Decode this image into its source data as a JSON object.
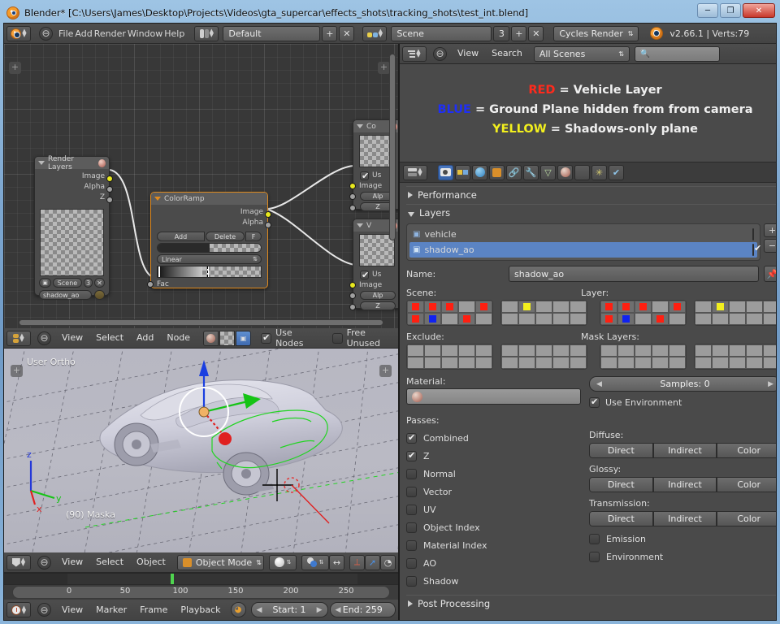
{
  "window": {
    "title": "Blender* [C:\\Users\\James\\Desktop\\Projects\\Videos\\gta_supercar\\effects_shots\\tracking_shots\\test_int.blend]",
    "minimize": "─",
    "maximize": "❐",
    "close": "✕",
    "app_icon": "blender-logo-icon"
  },
  "topbar": {
    "editor_type": "info-editor-icon",
    "menus": [
      "File",
      "Add",
      "Render",
      "Window",
      "Help"
    ],
    "screen_layout_icon": "screen-layout-icon",
    "screen_layout": "Default",
    "screen_add": "+",
    "screen_delete": "✕",
    "scene_icon": "scene-icon",
    "scene_name": "Scene",
    "scene_users": "3",
    "scene_add": "+",
    "scene_delete": "✕",
    "render_engine": "Cycles Render",
    "version_text": "v2.66.1 | Verts:79"
  },
  "node_editor": {
    "header": {
      "editor_type": "node-editor-icon",
      "menus": [
        "View",
        "Select",
        "Add",
        "Node"
      ],
      "shader_icon": "material-shading-icon",
      "texture_icon": "texture-icon",
      "compositing_icon": "compositing-icon",
      "use_nodes_label": "Use Nodes",
      "use_nodes_checked": true,
      "free_unused_label": "Free Unused",
      "free_unused_checked": false
    },
    "nodes": [
      {
        "name": "Render Layers",
        "title": "Render Layers",
        "outputs": [
          "Image",
          "Alpha",
          "Z"
        ],
        "scene_field": "Scene",
        "scene_users": "3",
        "layer_field": "shadow_ao"
      },
      {
        "name": "ColorRamp",
        "title": "ColorRamp",
        "outputs": [
          "Image",
          "Alpha"
        ],
        "add_label": "Add",
        "delete_label": "Delete",
        "f_label": "F",
        "interpolation": "Linear",
        "input": "Fac"
      },
      {
        "name": "Composite",
        "title": "Co",
        "use_label": "Us",
        "inputs": [
          "Image",
          "Alp",
          "Z"
        ]
      },
      {
        "name": "Viewer",
        "title": "V",
        "use_label": "Us",
        "inputs": [
          "Image",
          "Alp",
          "Z"
        ]
      }
    ]
  },
  "viewport": {
    "view_label": "User Ortho",
    "object_label": "(90) Maska",
    "axis": {
      "z": "z",
      "y": "y",
      "x": "x"
    },
    "header": {
      "editor_type": "3d-view-icon",
      "menus": [
        "View",
        "Select",
        "Object"
      ],
      "mode_icon": "object-mode-icon",
      "mode": "Object Mode",
      "shading": "solid-shading-icon",
      "pivot": "pivot-icon",
      "snap": "snap-icon",
      "manipulator": "manipulator-icon",
      "transform": "transform-arrow-icon"
    }
  },
  "timeline": {
    "ticks": [
      "0",
      "50",
      "100",
      "150",
      "200",
      "250"
    ],
    "current_frame_marker": 90,
    "header": {
      "editor_type": "timeline-icon",
      "menus": [
        "View",
        "Marker",
        "Frame",
        "Playback"
      ],
      "sync_icon": "sync-icon",
      "start_label": "Start: 1",
      "end_label": "End: 259"
    }
  },
  "outliner": {
    "editor_type": "outliner-icon",
    "menus": [
      "View",
      "Search"
    ],
    "display_mode": "All Scenes",
    "search_icon": "search-icon",
    "search_value": "",
    "search_placeholder": ""
  },
  "note": {
    "lines": [
      {
        "key": "RED",
        "key_color": "#ff2a1c",
        "text": " = Vehicle Layer"
      },
      {
        "key": "BLUE",
        "key_color": "#1f2ff5",
        "text": " = Ground Plane hidden from from camera"
      },
      {
        "key": "YELLOW",
        "key_color": "#f2ef1e",
        "text": " = Shadows-only plane"
      }
    ]
  },
  "properties": {
    "editor_type": "properties-icon",
    "tabs": [
      {
        "name": "render",
        "icon": "camera-icon",
        "active": true
      },
      {
        "name": "scene",
        "icon": "scene-icon",
        "active": false
      },
      {
        "name": "world",
        "icon": "world-icon",
        "active": false
      },
      {
        "name": "object",
        "icon": "cube-icon",
        "active": false
      },
      {
        "name": "constraints",
        "icon": "chain-icon",
        "active": false
      },
      {
        "name": "modifiers",
        "icon": "wrench-icon",
        "active": false
      },
      {
        "name": "data",
        "icon": "mesh-data-icon",
        "active": false
      },
      {
        "name": "material",
        "icon": "material-sphere-icon",
        "active": false
      },
      {
        "name": "texture",
        "icon": "checker-texture-icon",
        "active": false
      },
      {
        "name": "particles",
        "icon": "particles-icon",
        "active": false
      },
      {
        "name": "physics",
        "icon": "physics-icon",
        "active": false
      }
    ],
    "panels": {
      "performance": {
        "label": "Performance",
        "open": false
      },
      "layers": {
        "label": "Layers",
        "open": true
      },
      "post_processing": {
        "label": "Post Processing",
        "open": false
      }
    },
    "render_layers": [
      {
        "name": "vehicle",
        "enabled": false,
        "selected": false,
        "icon": "renderlayer-icon"
      },
      {
        "name": "shadow_ao",
        "enabled": true,
        "selected": true,
        "icon": "renderlayer-icon"
      }
    ],
    "list_add": "+",
    "list_remove": "−",
    "name_label": "Name:",
    "name_value": "shadow_ao",
    "pin_icon": "pin-icon",
    "scene_label": "Scene:",
    "layer_label": "Layer:",
    "exclude_label": "Exclude:",
    "mask_layers_label": "Mask Layers:",
    "scene_grid": {
      "block1": [
        [
          "red",
          "red",
          "red",
          "",
          "red"
        ],
        [
          "red",
          "blue",
          "",
          "red",
          ""
        ]
      ],
      "block2": [
        [
          "",
          "yellow",
          "",
          "",
          ""
        ],
        [
          "",
          "",
          "",
          "",
          ""
        ]
      ]
    },
    "layer_grid": {
      "block1": [
        [
          "red",
          "red",
          "red",
          "",
          "red"
        ],
        [
          "red",
          "blue",
          "",
          "red",
          ""
        ]
      ],
      "block2": [
        [
          "",
          "yellow",
          "",
          "",
          ""
        ],
        [
          "",
          "",
          "",
          "",
          ""
        ]
      ]
    },
    "exclude_grid": {
      "block1": [
        [
          "",
          "",
          "",
          "",
          ""
        ],
        [
          "",
          "",
          "",
          "",
          ""
        ]
      ],
      "block2": [
        [
          "",
          "",
          "",
          "",
          ""
        ],
        [
          "",
          "",
          "",
          "",
          ""
        ]
      ]
    },
    "mask_grid": {
      "block1": [
        [
          "",
          "",
          "",
          "",
          ""
        ],
        [
          "",
          "",
          "",
          "",
          ""
        ]
      ],
      "block2": [
        [
          "",
          "",
          "",
          "",
          ""
        ],
        [
          "",
          "",
          "",
          "",
          ""
        ]
      ]
    },
    "material_label": "Material:",
    "material_value": "",
    "material_icon": "material-sphere-icon",
    "samples_label": "Samples: 0",
    "use_environment_label": "Use Environment",
    "use_environment_checked": true,
    "passes_label": "Passes:",
    "passes": [
      {
        "label": "Combined",
        "checked": true
      },
      {
        "label": "Z",
        "checked": true
      },
      {
        "label": "Normal",
        "checked": false
      },
      {
        "label": "Vector",
        "checked": false
      },
      {
        "label": "UV",
        "checked": false
      },
      {
        "label": "Object Index",
        "checked": false
      },
      {
        "label": "Material Index",
        "checked": false
      },
      {
        "label": "AO",
        "checked": false
      },
      {
        "label": "Shadow",
        "checked": false
      }
    ],
    "pass_groups": [
      {
        "label": "Diffuse:",
        "buttons": [
          "Direct",
          "Indirect",
          "Color"
        ]
      },
      {
        "label": "Glossy:",
        "buttons": [
          "Direct",
          "Indirect",
          "Color"
        ]
      },
      {
        "label": "Transmission:",
        "buttons": [
          "Direct",
          "Indirect",
          "Color"
        ]
      }
    ],
    "extra_passes": [
      {
        "label": "Emission",
        "checked": false
      },
      {
        "label": "Environment",
        "checked": false
      }
    ]
  },
  "colors": {
    "red": "#ff1f11",
    "blue": "#1022f0",
    "yellow": "#f2ef1e",
    "select_blue": "#5b84c4",
    "accent_orange": "#e08a1e"
  }
}
